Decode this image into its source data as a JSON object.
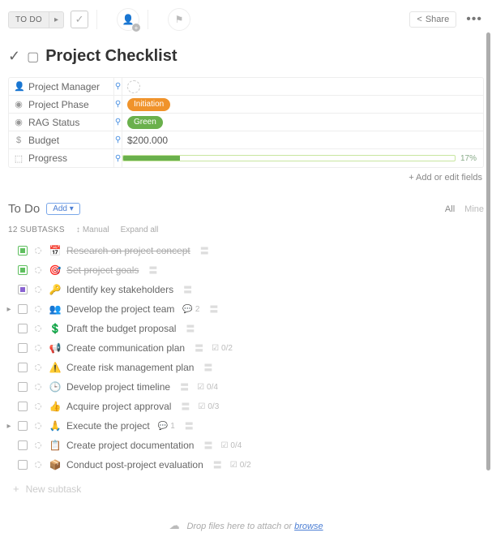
{
  "topbar": {
    "status": "TO DO",
    "share": "Share"
  },
  "title": "Project Checklist",
  "fields": [
    {
      "icon": "👤",
      "label": "Project Manager",
      "type": "avatar"
    },
    {
      "icon": "◉",
      "label": "Project Phase",
      "type": "pill",
      "value": "Initiation",
      "color": "#f0932b"
    },
    {
      "icon": "◉",
      "label": "RAG Status",
      "type": "pill",
      "value": "Green",
      "color": "#6ab04c"
    },
    {
      "icon": "$",
      "label": "Budget",
      "type": "text",
      "value": "$200.000"
    },
    {
      "icon": "⬚",
      "label": "Progress",
      "type": "progress",
      "pct": 17,
      "color": "#6ab04c"
    }
  ],
  "add_edit": "+ Add or edit fields",
  "section": {
    "title": "To Do",
    "add": "Add ▾",
    "all": "All",
    "mine": "Mine"
  },
  "subbar": {
    "count": "12 SUBTASKS",
    "sort": "Manual",
    "expand": "Expand all"
  },
  "tasks": [
    {
      "state": "done",
      "expand": false,
      "emoji": "📅",
      "title": "Research on project concept",
      "strike": true
    },
    {
      "state": "done",
      "expand": false,
      "emoji": "🎯",
      "title": "Set project goals",
      "strike": true
    },
    {
      "state": "purple",
      "expand": false,
      "emoji": "🔑",
      "title": "Identify key stakeholders"
    },
    {
      "state": "open",
      "expand": true,
      "emoji": "👥",
      "title": "Develop the project team",
      "comments": "2"
    },
    {
      "state": "open",
      "expand": false,
      "emoji": "💲",
      "title": "Draft the budget proposal"
    },
    {
      "state": "open",
      "expand": false,
      "emoji": "📢",
      "title": "Create communication plan",
      "sub": "0/2"
    },
    {
      "state": "open",
      "expand": false,
      "emoji": "⚠️",
      "title": "Create risk management plan"
    },
    {
      "state": "open",
      "expand": false,
      "emoji": "🕒",
      "title": "Develop project timeline",
      "sub": "0/4"
    },
    {
      "state": "open",
      "expand": false,
      "emoji": "👍",
      "title": "Acquire project approval",
      "sub": "0/3"
    },
    {
      "state": "open",
      "expand": true,
      "emoji": "🙏",
      "title": "Execute the project",
      "comments": "1"
    },
    {
      "state": "open",
      "expand": false,
      "emoji": "📋",
      "title": "Create project documentation",
      "sub": "0/4"
    },
    {
      "state": "open",
      "expand": false,
      "emoji": "📦",
      "title": "Conduct post-project evaluation",
      "sub": "0/2"
    }
  ],
  "new_subtask": "New subtask",
  "dropzone": {
    "text": "Drop files here to attach or ",
    "link": "browse"
  }
}
